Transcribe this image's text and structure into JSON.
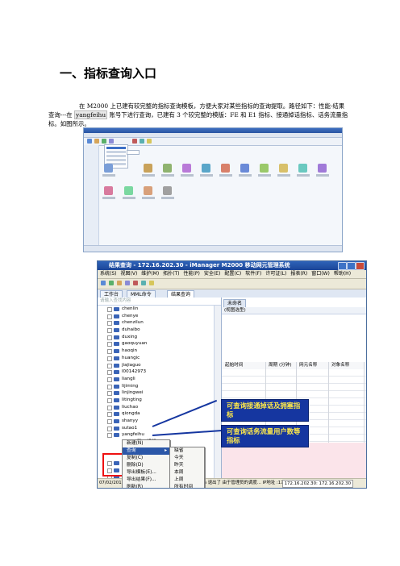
{
  "heading": "一、指标查询入口",
  "paragraph": {
    "before": "在 M2000 上已建有较完整的指标查询模板，方便大家对某些指标的查询提取。路径如下：性能-结果查询---在 ",
    "highlight": "yangfeihu",
    "after": " 账号下进行查询，已建有 3 个较完整的模版：FE 和 E1 指标、接通掉话指标、话务流量指标。如图所示。"
  },
  "screenshot2": {
    "title": "结果查询 - 172.16.202.30 - iManager M2000 移动网元管理系统",
    "menu": [
      "系统(S)",
      "视图(V)",
      "维护(M)",
      "拓扑(T)",
      "性能(P)",
      "安全(E)",
      "配置(C)",
      "软件(F)",
      "许可证(L)",
      "报表(R)",
      "窗口(W)",
      "帮助(H)"
    ],
    "tabs": [
      "工作台",
      "MML命令",
      "结果查询"
    ],
    "search_placeholder": "请输入查找内容",
    "tree_nodes": [
      "chenlin",
      "chenye",
      "chenzilun",
      "duhaibo",
      "duxing",
      "gaoquyuan",
      "haoqin",
      "huangic",
      "jiajiaguo",
      "l00142973",
      "liangli",
      "lijiming",
      "linjingwei",
      "litingting",
      "liuchao",
      "qiongda",
      "shanyy",
      "sutao1",
      "yangfeihu"
    ],
    "child_nodes": [
      "FE和E1指标",
      "接通掉话指标",
      "话务流量指标"
    ],
    "tree_nodes_after": [
      "yedanhua",
      "z00149462",
      "z00150493",
      "zhangch",
      "zhangh",
      "zhangqimin",
      "zhoujun",
      "zhouxin"
    ],
    "right_tab": "未命名",
    "right_query": "(视图选型)",
    "columns": [
      "起始时间",
      "周期 (分钟)",
      "网元名称",
      "对象名称"
    ],
    "status": "07/02/2013 09:45:50 - 欢迎使用！ 当前用户: admin 退出了 由于管理员的调度... IP地址 :17.21.2.19。 用户...",
    "status_ip": "172.16.202.30: 172.16.202.30",
    "context_menu": [
      "新建(N)",
      "查询",
      "复制(C)",
      "删除(D)",
      "导出模板(E)...",
      "导出结果(F)...",
      "刷新(R)"
    ],
    "submenu": [
      "缺省",
      "今天",
      "昨天",
      "本周",
      "上周",
      "所有时间",
      "指定"
    ],
    "callout1": "可查询接通掉话及拥塞指标",
    "callout2": "可查询话务流量用户数等指标"
  }
}
